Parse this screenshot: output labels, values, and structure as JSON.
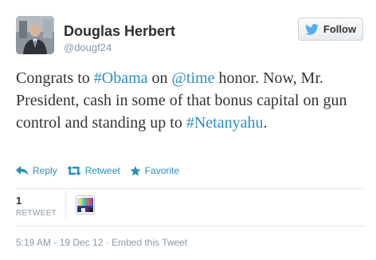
{
  "user": {
    "name": "Douglas Herbert",
    "handle": "@dougf24"
  },
  "follow_button": {
    "label": "Follow"
  },
  "tweet": {
    "segments": [
      {
        "text": "Congrats to "
      },
      {
        "text": "#Obama",
        "link": true
      },
      {
        "text": " on "
      },
      {
        "text": "@time",
        "link": true
      },
      {
        "text": " honor. Now, Mr. President, cash in some of that bonus capital on gun control and standing up to "
      },
      {
        "text": "#Netanyahu",
        "link": true
      },
      {
        "text": "."
      }
    ]
  },
  "actions": {
    "reply": "Reply",
    "retweet": "Retweet",
    "favorite": "Favorite"
  },
  "stats": {
    "retweet_count": "1",
    "retweet_label": "RETWEET"
  },
  "footer": {
    "timestamp": "5:19 AM - 19 Dec 12",
    "separator": "·",
    "embed": "Embed this Tweet"
  },
  "colors": {
    "link": "#2a8fbd",
    "twitter_bird": "#55acee",
    "muted": "#8899a6"
  },
  "icons": [
    "twitter-bird-icon",
    "reply-icon",
    "retweet-icon",
    "favorite-star-icon"
  ]
}
